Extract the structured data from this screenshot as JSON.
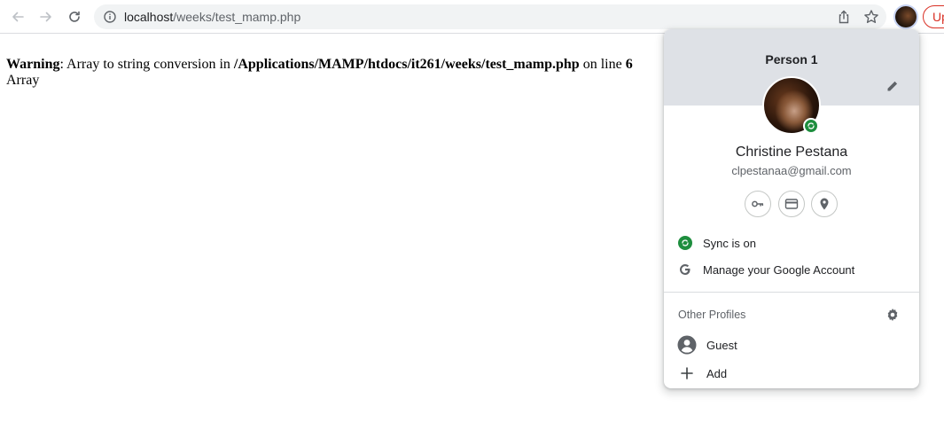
{
  "toolbar": {
    "back_icon": "arrow-left-icon",
    "forward_icon": "arrow-right-icon",
    "reload_icon": "reload-icon",
    "url_host": "localhost",
    "url_path": "/weeks/test_mamp.php",
    "update_label": "Up"
  },
  "page": {
    "warning_label": "Warning",
    "warning_text": ": Array to string conversion in ",
    "warning_path": "/Applications/MAMP/htdocs/it261/weeks/test_mamp.php",
    "warning_online": " on line ",
    "warning_line": "6",
    "output": "Array"
  },
  "profile_menu": {
    "title": "Person 1",
    "name": "Christine Pestana",
    "email": "clpestanaa@gmail.com",
    "quick_icons": [
      "key-icon",
      "credit-card-icon",
      "location-pin-icon"
    ],
    "sync_label": "Sync is on",
    "manage_label": "Manage your Google Account",
    "other_profiles_label": "Other Profiles",
    "guest_label": "Guest",
    "add_label": "Add"
  },
  "colors": {
    "sync_green": "#1e8e3e",
    "header_gray": "#dee1e6",
    "update_red": "#d93025"
  }
}
